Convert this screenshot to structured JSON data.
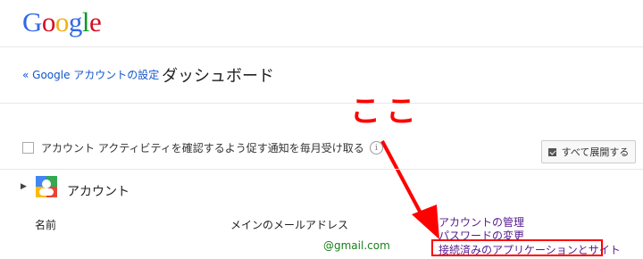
{
  "logo": {
    "text": "Google"
  },
  "header": {
    "back_link": "« Google アカウントの設定",
    "page_title": "ダッシュボード"
  },
  "annotation": {
    "text": "ここ",
    "color": "#ff0000"
  },
  "notify": {
    "label": "アカウント アクティビティを確認するよう促す通知を毎月受け取る",
    "checked": false,
    "info_icon": "i"
  },
  "expand_button": {
    "label": "すべて展開する"
  },
  "account_section": {
    "title": "アカウント",
    "name_label": "名前",
    "email_label": "メインのメールアドレス",
    "email_value": "@gmail.com",
    "links": {
      "manage": "アカウントの管理",
      "password": "パスワードの変更",
      "connected_apps": "接続済みのアプリケーションとサイト"
    }
  }
}
